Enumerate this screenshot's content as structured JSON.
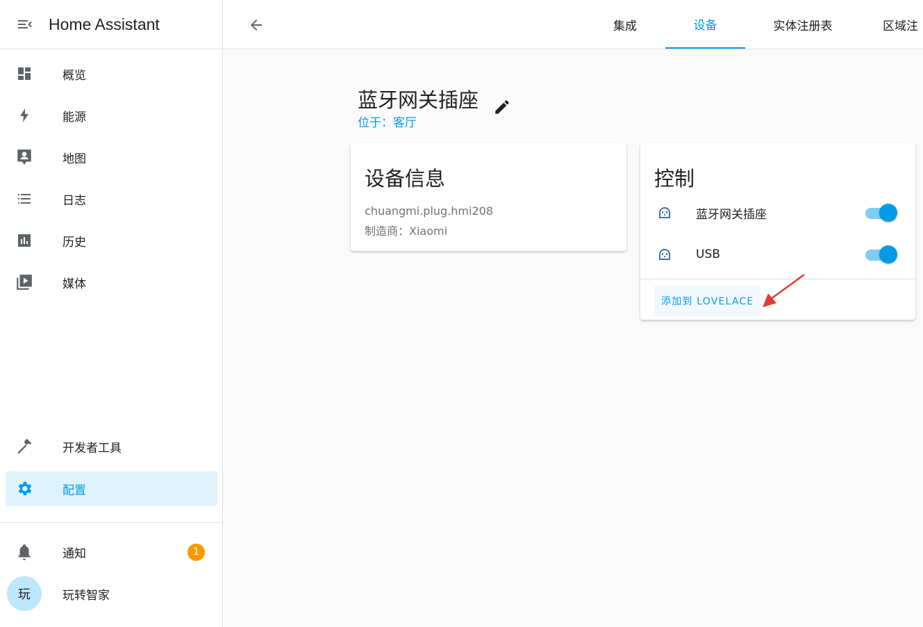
{
  "app": {
    "title": "Home Assistant"
  },
  "sidebar": {
    "items": [
      {
        "label": "概览",
        "icon": "dashboard-icon"
      },
      {
        "label": "能源",
        "icon": "lightning-icon"
      },
      {
        "label": "地图",
        "icon": "map-account-icon"
      },
      {
        "label": "日志",
        "icon": "list-icon"
      },
      {
        "label": "历史",
        "icon": "chart-icon"
      },
      {
        "label": "媒体",
        "icon": "media-icon"
      }
    ],
    "dev_tools": {
      "label": "开发者工具",
      "icon": "hammer-icon"
    },
    "config": {
      "label": "配置",
      "icon": "gear-icon"
    },
    "notifications": {
      "label": "通知",
      "icon": "bell-icon",
      "badge": "1"
    },
    "user": {
      "label": "玩转智家",
      "avatar": "玩"
    }
  },
  "tabs": [
    {
      "label": "集成"
    },
    {
      "label": "设备"
    },
    {
      "label": "实体注册表"
    },
    {
      "label": "区域注"
    }
  ],
  "device": {
    "name": "蓝牙网关插座",
    "area": "位于：客厅"
  },
  "info_card": {
    "title": "设备信息",
    "model": "chuangmi.plug.hmi208",
    "manufacturer": "制造商：Xiaomi"
  },
  "control_card": {
    "title": "控制",
    "rows": [
      {
        "label": "蓝牙网关插座",
        "icon": "power-socket-icon",
        "state": "on"
      },
      {
        "label": "USB",
        "icon": "power-socket-icon",
        "state": "on"
      }
    ],
    "add_button": "添加到 LOVELACE"
  },
  "colors": {
    "accent": "#039be5",
    "badge": "#ff9800",
    "annotation": "#e53935"
  }
}
